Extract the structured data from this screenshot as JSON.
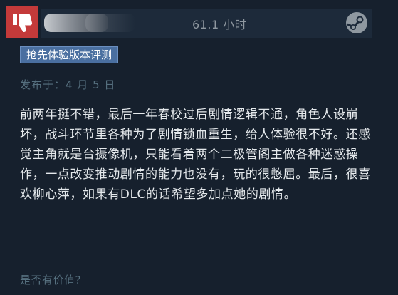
{
  "header": {
    "hours_played": "61.1 小时",
    "recommendation_icon": "thumbs-down-icon",
    "platform_icon": "steam-icon"
  },
  "badge": {
    "label": "抢先体验版本评测"
  },
  "meta": {
    "posted_date": "发布于：4 月 5 日"
  },
  "review": {
    "text": "前两年挺不错，最后一年春校过后剧情逻辑不通，角色人设崩坏，战斗环节里各种为了剧情锁血重生，给人体验很不好。还感觉主角就是台摄像机，只能看着两个二极管阁主做各种迷惑操作，一点改变推动剧情的能力也没有，玩的很憋屈。最后，很喜欢柳心萍，如果有DLC的话希望多加点她的剧情。"
  },
  "footer": {
    "helpful_prompt": "是否有价值?"
  },
  "colors": {
    "background": "#16202d",
    "not_recommended": "#c43a3a",
    "badge": "#4a6fa0",
    "muted_text": "#56707f"
  }
}
